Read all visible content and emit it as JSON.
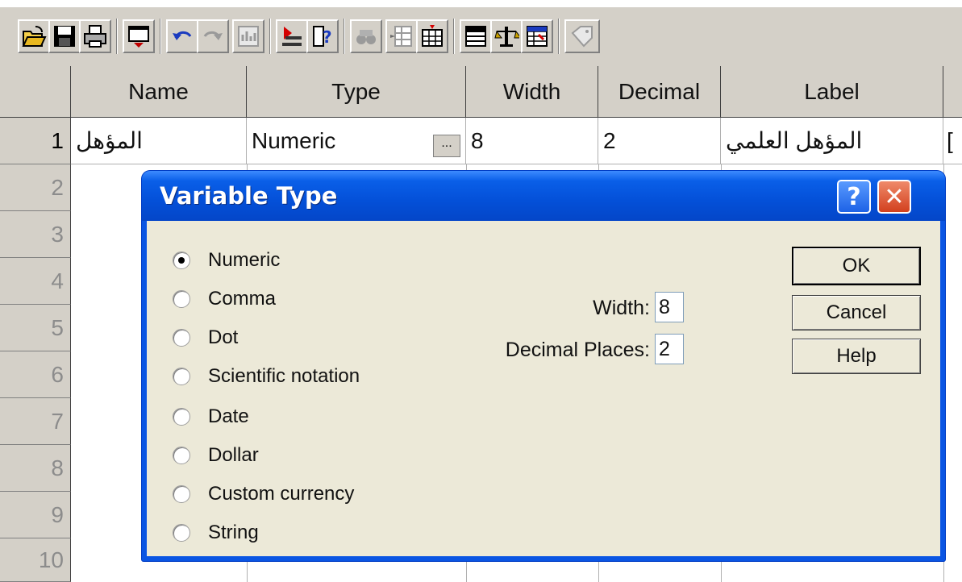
{
  "toolbar": {
    "icons": [
      "open-icon",
      "save-icon",
      "print-icon",
      "dialog-recall-icon",
      "undo-icon",
      "redo-icon",
      "chart-builder-icon",
      "goto-case-icon",
      "variables-icon",
      "find-icon",
      "insert-cases-icon",
      "insert-variable-icon",
      "split-file-icon",
      "weight-cases-icon",
      "select-cases-icon",
      "value-labels-icon"
    ]
  },
  "grid": {
    "columns": [
      "Name",
      "Type",
      "Width",
      "Decimal",
      "Label"
    ],
    "rows": [
      "1",
      "2",
      "3",
      "4",
      "5",
      "6",
      "7",
      "8",
      "9",
      "10"
    ],
    "row1": {
      "name": "المؤهل",
      "type": "Numeric",
      "ellipsis": "...",
      "width": "8",
      "decimals": "2",
      "label": "المؤهل العلمي",
      "edge": "["
    }
  },
  "dialog": {
    "title": "Variable Type",
    "help_glyph": "?",
    "close_glyph": "✕",
    "options": [
      "Numeric",
      "Comma",
      "Dot",
      "Scientific notation",
      "Date",
      "Dollar",
      "Custom currency",
      "String"
    ],
    "selected": "Numeric",
    "width_label": "Width:",
    "width_value": "8",
    "decimal_label": "Decimal Places:",
    "decimal_value": "2",
    "ok_label": "OK",
    "cancel_label": "Cancel",
    "help_label": "Help"
  }
}
